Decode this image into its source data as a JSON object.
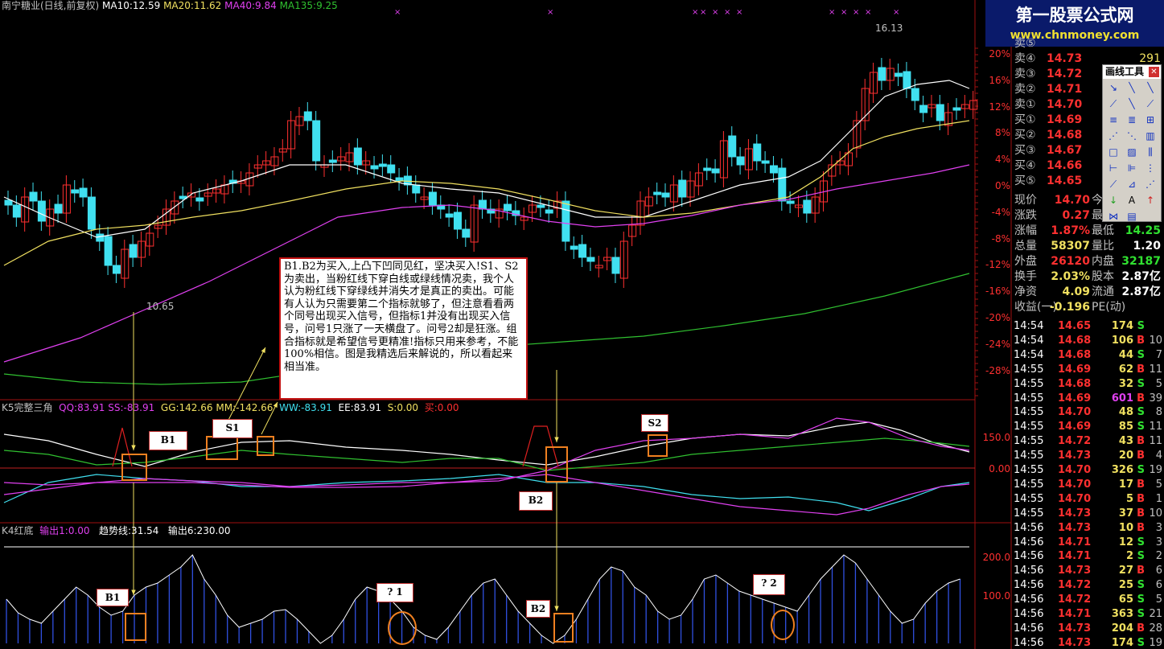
{
  "header": {
    "title": "南宁糖业(日线,前复权)",
    "ma10": "MA10:12.59",
    "ma20": "MA20:11.62",
    "ma40": "MA40:9.84",
    "ma135": "MA135:9.25"
  },
  "main_axis": [
    "20%",
    "16%",
    "12%",
    "8%",
    "4%",
    "0%",
    "-4%",
    "-8%",
    "-12%",
    "-16%",
    "-20%",
    "-24%",
    "-28%"
  ],
  "high_label": "16.13",
  "low_label": "10.65",
  "ind1": {
    "name": "K5完整三角",
    "qq": "QQ:83.91",
    "ss": "SS:-83.91",
    "gg": "GG:142.66",
    "mm": "MM:-142.66",
    "ww": "WW:-83.91",
    "ee": "EE:83.91",
    "s": "S:0.00",
    "buy": "买:0.00",
    "axis": [
      "150.0",
      "0.00"
    ]
  },
  "ind2": {
    "name": "K4红底",
    "out1": "输出1:0.00",
    "trend": "趋势线:31.54",
    "out6": "输出6:230.00",
    "axis": [
      "200.0",
      "100.0"
    ]
  },
  "labels": {
    "b1": "B1",
    "s1": "S1",
    "s2": "S2",
    "b2": "B2",
    "b1b": "B1",
    "q1": "? 1",
    "b2b": "B2",
    "q2": "? 2"
  },
  "note": "B1.B2为买入,上凸下凹同见红，坚决买入!S1、S2为卖出，当粉红线下穿白线或绿线情况卖，我个人认为粉红线下穿绿线并消失才是真正的卖出。可能有人认为只需要第二个指标就够了，但注意看看两个同号出现买入信号，但指标1并没有出现买入信号，问号1只涨了一天横盘了。问号2却是狂涨。组合指标就是希望信号更精准!指标只用来参考，不能100%相信。图是我精选后来解说的，所以看起来相当准。",
  "logo": {
    "name": "第一股票公式网",
    "url": "www.chnmoney.com"
  },
  "orders": [
    {
      "label": "卖⑤",
      "price": "",
      "vol": ""
    },
    {
      "label": "卖④",
      "price": "14.73",
      "vol": "291"
    },
    {
      "label": "卖③",
      "price": "14.72",
      "vol": ""
    },
    {
      "label": "卖②",
      "price": "14.71",
      "vol": ""
    },
    {
      "label": "卖①",
      "price": "14.70",
      "vol": ""
    },
    {
      "label": "买①",
      "price": "14.69",
      "vol": ""
    },
    {
      "label": "买②",
      "price": "14.68",
      "vol": ""
    },
    {
      "label": "买③",
      "price": "14.67",
      "vol": ""
    },
    {
      "label": "买④",
      "price": "14.66",
      "vol": ""
    },
    {
      "label": "买⑤",
      "price": "14.65",
      "vol": ""
    }
  ],
  "quote": [
    {
      "l1": "现价",
      "v1": "14.70",
      "l2": "今",
      "v2": ""
    },
    {
      "l1": "涨跌",
      "v1": "0.27",
      "l2": "最",
      "v2": ""
    },
    {
      "l1": "涨幅",
      "v1": "1.87%",
      "l2": "最低",
      "v2": "14.25"
    },
    {
      "l1": "总量",
      "v1": "58307",
      "l2": "量比",
      "v2": "1.20"
    },
    {
      "l1": "外盘",
      "v1": "26120",
      "l2": "内盘",
      "v2": "32187"
    },
    {
      "l1": "换手",
      "v1": "2.03%",
      "l2": "股本",
      "v2": "2.87亿"
    },
    {
      "l1": "净资",
      "v1": "4.09",
      "l2": "流通",
      "v2": "2.87亿"
    },
    {
      "l1": "收益(一)",
      "v1": "-0.196",
      "l2": "PE(动)",
      "v2": ""
    }
  ],
  "ticks": [
    [
      "14:54",
      "14.65",
      "174",
      "S",
      ""
    ],
    [
      "14:54",
      "14.68",
      "106",
      "B",
      "10"
    ],
    [
      "14:54",
      "14.68",
      "44",
      "S",
      "7"
    ],
    [
      "14:55",
      "14.69",
      "62",
      "B",
      "11"
    ],
    [
      "14:55",
      "14.68",
      "32",
      "S",
      "5"
    ],
    [
      "14:55",
      "14.69",
      "601",
      "B",
      "39"
    ],
    [
      "14:55",
      "14.70",
      "48",
      "S",
      "8"
    ],
    [
      "14:55",
      "14.69",
      "85",
      "S",
      "11"
    ],
    [
      "14:55",
      "14.72",
      "43",
      "B",
      "11"
    ],
    [
      "14:55",
      "14.73",
      "20",
      "B",
      "4"
    ],
    [
      "14:55",
      "14.70",
      "326",
      "S",
      "19"
    ],
    [
      "14:55",
      "14.70",
      "17",
      "B",
      "5"
    ],
    [
      "14:55",
      "14.70",
      "5",
      "B",
      "1"
    ],
    [
      "14:55",
      "14.73",
      "37",
      "B",
      "10"
    ],
    [
      "14:56",
      "14.73",
      "10",
      "B",
      "3"
    ],
    [
      "14:56",
      "14.71",
      "12",
      "S",
      "3"
    ],
    [
      "14:56",
      "14.71",
      "2",
      "S",
      "2"
    ],
    [
      "14:56",
      "14.73",
      "27",
      "B",
      "6"
    ],
    [
      "14:56",
      "14.72",
      "25",
      "S",
      "6"
    ],
    [
      "14:56",
      "14.72",
      "65",
      "S",
      "5"
    ],
    [
      "14:56",
      "14.71",
      "363",
      "S",
      "21"
    ],
    [
      "14:56",
      "14.73",
      "204",
      "B",
      "28"
    ],
    [
      "14:56",
      "14.73",
      "174",
      "S",
      "19"
    ]
  ],
  "palette": {
    "title": "画线工具",
    "tools": [
      "↘",
      "╲",
      "╲",
      "⟋",
      "╲",
      "⟋",
      "≡",
      "≣",
      "⊞",
      "⋰",
      "⋱",
      "▥",
      "□",
      "▨",
      "⫼",
      "⊢",
      "⊫",
      "⋮",
      "⟋",
      "⊿",
      "⋰",
      "↓",
      "A",
      "↑",
      "⋈",
      "▤"
    ]
  },
  "colors": {
    "up": "#ff3030",
    "down": "#40e0f0",
    "ma10": "#ffffff",
    "ma20": "#f0e060",
    "ma40": "#e040f0",
    "ma135": "#30c030",
    "accent": "#f08020"
  }
}
